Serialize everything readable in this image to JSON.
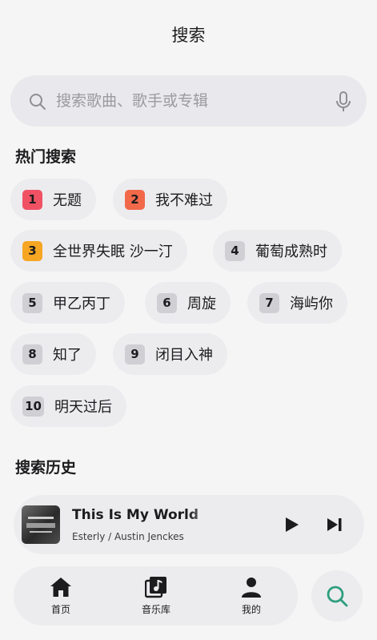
{
  "header": {
    "title": "搜索"
  },
  "search": {
    "placeholder": "搜索歌曲、歌手或专辑",
    "search_icon": "search-icon",
    "mic_icon": "microphone-icon"
  },
  "hot": {
    "title": "热门搜索",
    "items": [
      {
        "rank": "1",
        "label": "无题"
      },
      {
        "rank": "2",
        "label": "我不难过"
      },
      {
        "rank": "3",
        "label": "全世界失眠 沙一汀"
      },
      {
        "rank": "4",
        "label": "葡萄成熟时"
      },
      {
        "rank": "5",
        "label": "甲乙丙丁"
      },
      {
        "rank": "6",
        "label": "周旋"
      },
      {
        "rank": "7",
        "label": "海屿你"
      },
      {
        "rank": "8",
        "label": "知了"
      },
      {
        "rank": "9",
        "label": "闭目入神"
      },
      {
        "rank": "10",
        "label": "明天过后"
      }
    ],
    "rank_colors": {
      "1": "#f05264",
      "2": "#f2694a",
      "3": "#f6a623",
      "default": "#d0d0d4"
    }
  },
  "history": {
    "title": "搜索历史"
  },
  "now_playing": {
    "title": "This Is My World",
    "artist": "Esterly / Austin Jenckes",
    "play_icon": "play-icon",
    "next_icon": "skip-next-icon"
  },
  "nav": {
    "tabs": [
      {
        "label": "首页",
        "icon": "home-icon"
      },
      {
        "label": "音乐库",
        "icon": "music-library-icon"
      },
      {
        "label": "我的",
        "icon": "person-icon"
      }
    ],
    "search_button_icon": "search-icon",
    "accent": "#2f9e7f"
  }
}
